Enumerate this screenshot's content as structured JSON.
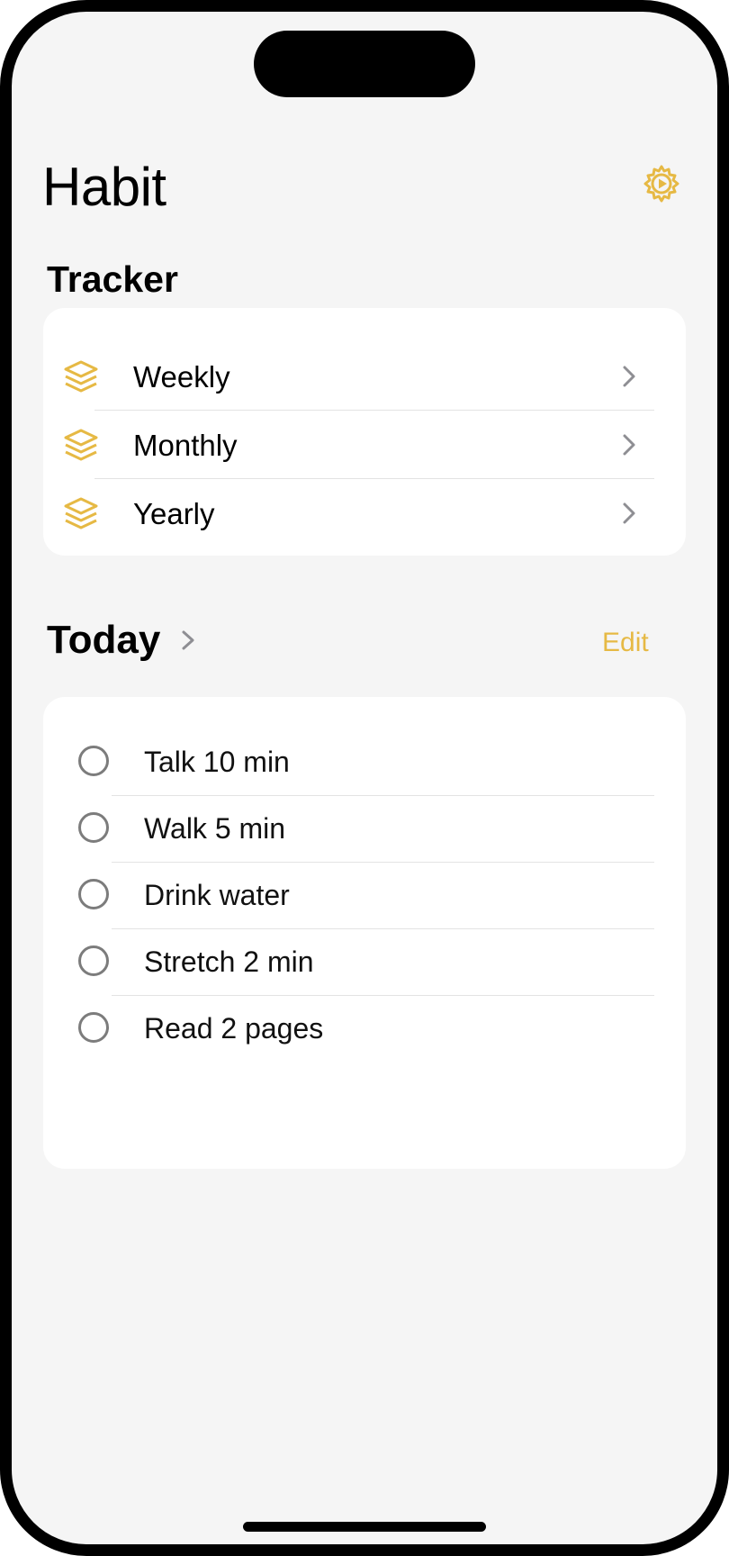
{
  "app": {
    "title": "Habit",
    "settings_icon": "gear-play-icon",
    "accent_color": "#E6B944"
  },
  "tracker": {
    "title": "Tracker",
    "items": [
      {
        "label": "Weekly",
        "icon": "layers-icon"
      },
      {
        "label": "Monthly",
        "icon": "layers-icon"
      },
      {
        "label": "Yearly",
        "icon": "layers-icon"
      }
    ]
  },
  "today": {
    "title": "Today",
    "edit_label": "Edit",
    "habits": [
      {
        "label": "Talk 10 min",
        "checked": false
      },
      {
        "label": "Walk 5 min",
        "checked": false
      },
      {
        "label": "Drink water",
        "checked": false
      },
      {
        "label": "Stretch 2 min",
        "checked": false
      },
      {
        "label": "Read 2 pages",
        "checked": false
      }
    ]
  }
}
